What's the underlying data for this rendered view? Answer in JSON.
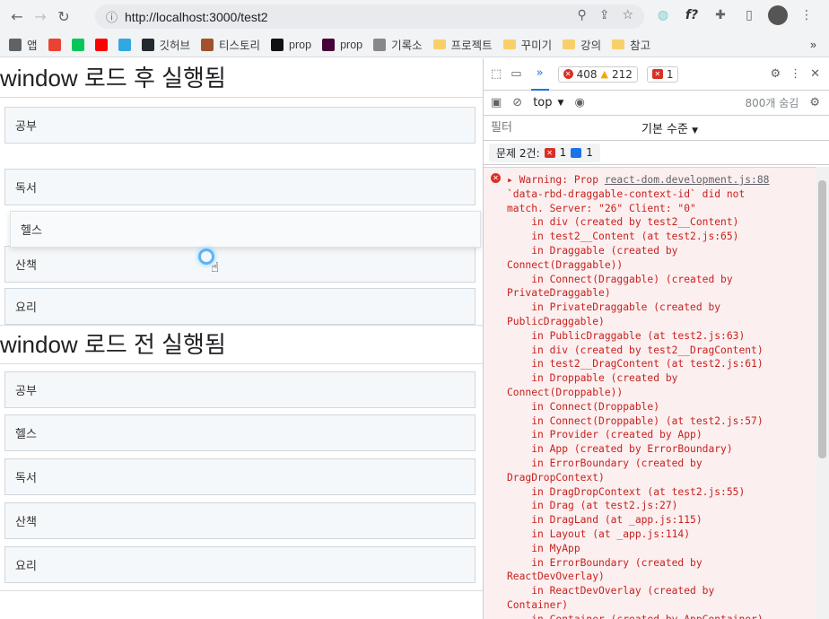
{
  "browser": {
    "url": "http://localhost:3000/test2",
    "bookmarks": [
      {
        "label": "앱",
        "icon": "apps-icon",
        "color": "#5f6368"
      },
      {
        "label": "",
        "icon": "google-icon",
        "color": "#ea4335"
      },
      {
        "label": "",
        "icon": "naver-icon",
        "color": "#03c75a"
      },
      {
        "label": "",
        "icon": "youtube-icon",
        "color": "#ff0000"
      },
      {
        "label": "",
        "icon": "edge-icon",
        "color": "#31a8e0"
      },
      {
        "label": "깃허브",
        "icon": "github-icon",
        "color": "#24292f"
      },
      {
        "label": "티스토리",
        "icon": "tistory-icon",
        "color": "#a0522d"
      },
      {
        "label": "prop",
        "icon": "notion-icon",
        "color": "#111111"
      },
      {
        "label": "prop",
        "icon": "xd-icon",
        "color": "#470137"
      },
      {
        "label": "기록소",
        "icon": "profile-icon",
        "color": "#888888"
      },
      {
        "label": "프로젝트",
        "icon": "folder-icon",
        "color": "#f9cf6a"
      },
      {
        "label": "꾸미기",
        "icon": "folder-icon",
        "color": "#f9cf6a"
      },
      {
        "label": "강의",
        "icon": "folder-icon",
        "color": "#f9cf6a"
      },
      {
        "label": "참고",
        "icon": "folder-icon",
        "color": "#f9cf6a"
      }
    ],
    "more_label": "»"
  },
  "page": {
    "section1_title": "window 로드 후 실행됨",
    "section1_items": [
      "공부",
      "독서",
      "헬스",
      "산책",
      "요리"
    ],
    "section2_title": "window 로드 전 실행됨",
    "section2_items": [
      "공부",
      "헬스",
      "독서",
      "산책",
      "요리"
    ]
  },
  "devtools": {
    "tab_more": "»",
    "error_count": "408",
    "warning_count": "212",
    "issue_count": "1",
    "context": "top",
    "hidden_label": "800개 숨김",
    "filter_placeholder": "필터",
    "level_label": "기본 수준",
    "issues_label": "문제 2건:",
    "issues_red": "1",
    "issues_blue": "1",
    "message_link": "react-dom.development.js:88",
    "message_lines": [
      "Warning: Prop ",
      "`data-rbd-draggable-context-id` did not",
      "match. Server: \"26\" Client: \"0\"",
      "    in div (created by test2__Content)",
      "    in test2__Content (at test2.js:65)",
      "    in Draggable (created by",
      "Connect(Draggable))",
      "    in Connect(Draggable) (created by",
      "PrivateDraggable)",
      "    in PrivateDraggable (created by",
      "PublicDraggable)",
      "    in PublicDraggable (at test2.js:63)",
      "    in div (created by test2__DragContent)",
      "    in test2__DragContent (at test2.js:61)",
      "    in Droppable (created by",
      "Connect(Droppable))",
      "    in Connect(Droppable)",
      "    in Connect(Droppable) (at test2.js:57)",
      "    in Provider (created by App)",
      "    in App (created by ErrorBoundary)",
      "    in ErrorBoundary (created by",
      "DragDropContext)",
      "    in DragDropContext (at test2.js:55)",
      "    in Drag (at test2.js:27)",
      "    in DragLand (at _app.js:115)",
      "    in Layout (at _app.js:114)",
      "    in MyApp",
      "    in ErrorBoundary (created by",
      "ReactDevOverlay)",
      "    in ReactDevOverlay (created by",
      "Container)",
      "    in Container (created by AppContainer)"
    ]
  }
}
